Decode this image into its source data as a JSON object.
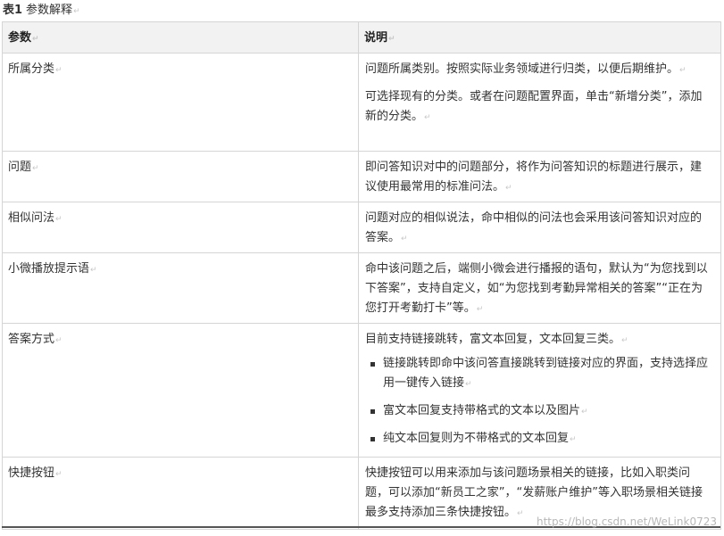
{
  "caption": {
    "label": "表1",
    "title": "参数解释"
  },
  "header": {
    "param": "参数",
    "desc": "说明"
  },
  "rows": [
    {
      "param": "所属分类",
      "desc": [
        "问题所属类别。按照实际业务领域进行归类，以便后期维护。",
        "可选择现有的分类。或者在问题配置界面，单击“新增分类”，添加新的分类。"
      ]
    },
    {
      "param": "问题",
      "desc": [
        "即问答知识对中的问题部分，将作为问答知识的标题进行展示，建议使用最常用的标准问法。"
      ]
    },
    {
      "param": "相似问法",
      "desc": [
        "问题对应的相似说法，命中相似的问法也会采用该问答知识对应的答案。"
      ]
    },
    {
      "param": "小微播放提示语",
      "desc": [
        "命中该问题之后，端侧小微会进行播报的语句，默认为“为您找到以下答案”，支持自定义，如“为您找到考勤异常相关的答案”“正在为您打开考勤打卡”等。"
      ]
    },
    {
      "param": "答案方式",
      "desc": [
        "目前支持链接跳转，富文本回复，文本回复三类。"
      ],
      "bullets": [
        "链接跳转即命中该问答直接跳转到链接对应的界面，支持选择应用一键传入链接",
        "富文本回复支持带格式的文本以及图片",
        "纯文本回复则为不带格式的文本回复"
      ]
    },
    {
      "param": "快捷按钮",
      "desc": [
        "快捷按钮可以用来添加与该问题场景相关的链接，比如入职类问题，可以添加“新员工之家”，“发薪账户维护”等入职场景相关链接最多支持添加三条快捷按钮。"
      ]
    }
  ],
  "watermark": "https://blog.csdn.net/WeLink0723"
}
